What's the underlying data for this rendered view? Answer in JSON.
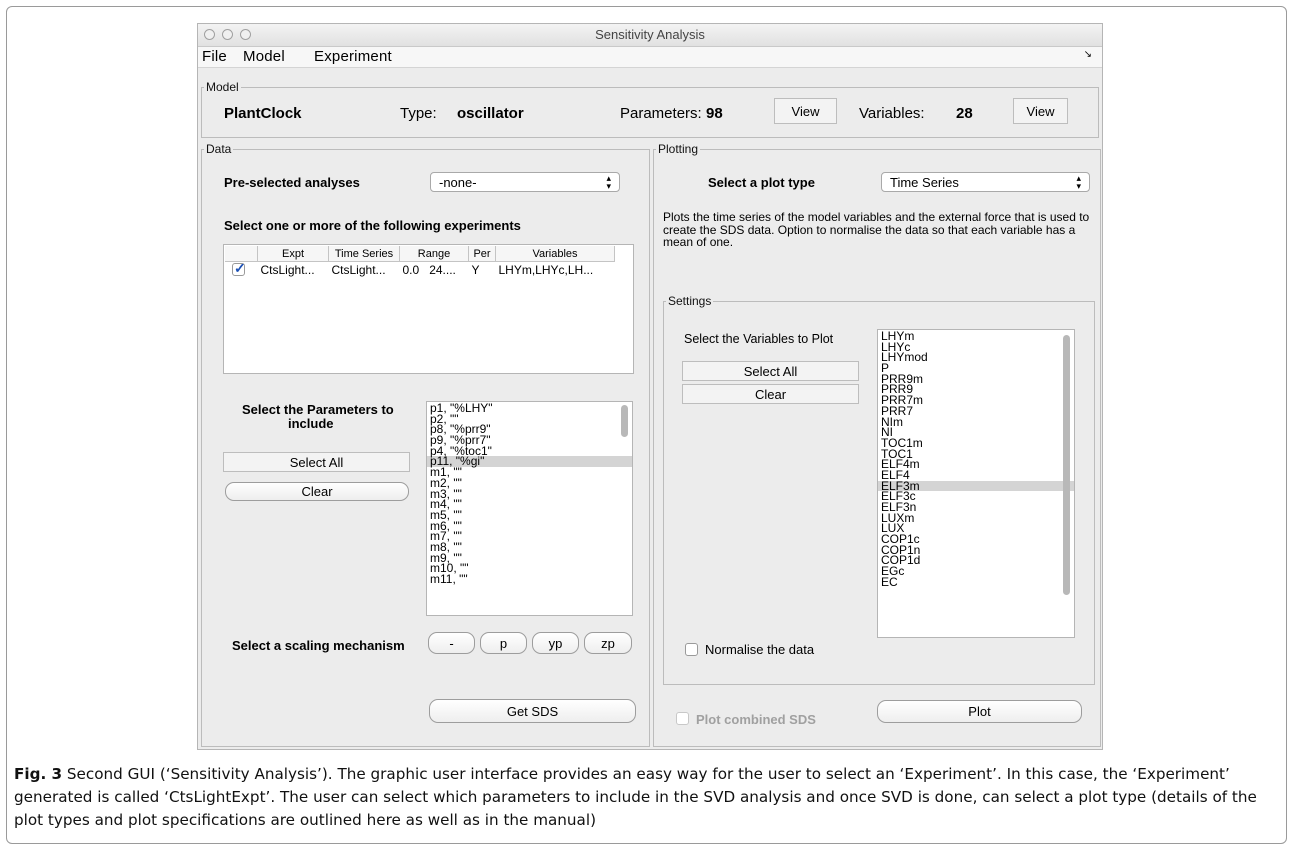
{
  "window": {
    "title": "Sensitivity Analysis",
    "menu": [
      "File",
      "Model",
      "Experiment"
    ],
    "menu_corner_icon": "resize-arrow-icon"
  },
  "model": {
    "legend": "Model",
    "name": "PlantClock",
    "type_label": "Type:",
    "type_value": "oscillator",
    "params_label": "Parameters:",
    "params_value": "98",
    "view_label": "View",
    "vars_label": "Variables:",
    "vars_value": "28"
  },
  "data_panel": {
    "legend": "Data",
    "preselected_label": "Pre-selected analyses",
    "preselected_value": "-none-",
    "experiments_label": "Select one or more of the following experiments",
    "table": {
      "headers": [
        "",
        "Expt",
        "Time Series",
        "Range",
        "Per",
        "Variables"
      ],
      "rows": [
        {
          "checked": true,
          "expt": "CtsLight...",
          "ts": "CtsLight...",
          "range_a": "0.0",
          "range_b": "24....",
          "per": "Y",
          "vars": "LHYm,LHYc,LH..."
        }
      ]
    },
    "params_label_1": "Select the Parameters to",
    "params_label_2": "include",
    "params_list": [
      "p1, \"%LHY\"",
      "p2, \"\"",
      "p8, \"%prr9\"",
      "p9, \"%prr7\"",
      "p4, \"%toc1\"",
      "p11, \"%gi\"",
      "m1, \"\"",
      "m2, \"\"",
      "m3, \"\"",
      "m4, \"\"",
      "m5, \"\"",
      "m6, \"\"",
      "m7, \"\"",
      "m8, \"\"",
      "m9, \"\"",
      "m10, \"\"",
      "m11, \"\""
    ],
    "params_selected_index": 5,
    "select_all": "Select All",
    "clear": "Clear",
    "scaling_label": "Select a scaling mechanism",
    "scaling_buttons": [
      "-",
      "p",
      "yp",
      "zp"
    ],
    "get_sds": "Get SDS"
  },
  "plotting": {
    "legend": "Plotting",
    "plot_type_label": "Select a plot type",
    "plot_type_value": "Time Series",
    "description": "Plots the time series of the model variables and the external force that is used to create the SDS data. Option to normalise the data so that each variable has a mean of one.",
    "settings_legend": "Settings",
    "vars_label": "Select the Variables to Plot",
    "select_all": "Select All",
    "clear": "Clear",
    "vars_list": [
      "LHYm",
      "LHYc",
      "LHYmod",
      "P",
      "PRR9m",
      "PRR9",
      "PRR7m",
      "PRR7",
      "NIm",
      "NI",
      "TOC1m",
      "TOC1",
      "ELF4m",
      "ELF4",
      "ELF3m",
      "ELF3c",
      "ELF3n",
      "LUXm",
      "LUX",
      "COP1c",
      "COP1n",
      "COP1d",
      "EGc",
      "EC"
    ],
    "vars_selected_index": 14,
    "normalise_label": "Normalise the data",
    "combined_label": "Plot combined SDS",
    "plot_button": "Plot"
  },
  "caption": {
    "fig_label": "Fig. 3",
    "text": "Second GUI (‘Sensitivity Analysis’). The graphic user interface provides an easy way for the user to select an ‘Experiment’. In this case, the ‘Experiment’ generated is called ‘CtsLightExpt’. The user can select which parameters to include in the SVD analysis and once SVD is done, can select a plot type (details of the plot types and plot specifications are outlined here as well as in the manual)"
  }
}
